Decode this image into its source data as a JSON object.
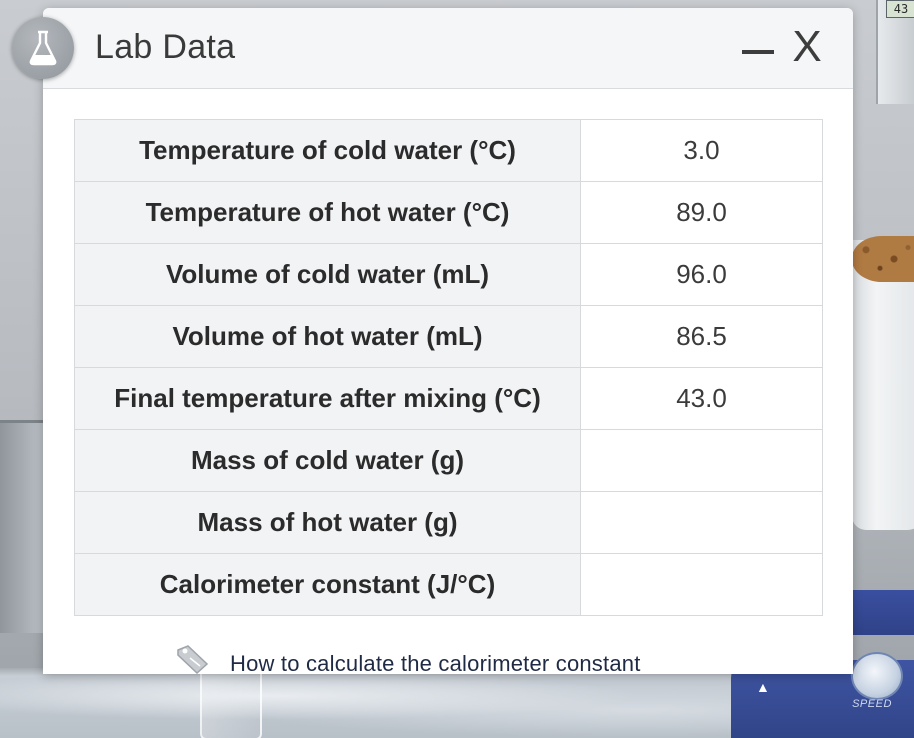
{
  "dialog": {
    "title": "Lab Data",
    "minimize_icon": "minimize-icon",
    "close_label": "X",
    "badge_icon": "flask-icon"
  },
  "table": {
    "rows": [
      {
        "label": "Temperature of cold water (°C)",
        "value": "3.0"
      },
      {
        "label": "Temperature of hot water (°C)",
        "value": "89.0"
      },
      {
        "label": "Volume of cold water (mL)",
        "value": "96.0"
      },
      {
        "label": "Volume of hot water (mL)",
        "value": "86.5"
      },
      {
        "label": "Final temperature after mixing (°C)",
        "value": "43.0"
      },
      {
        "label": "Mass of cold water (g)",
        "value": ""
      },
      {
        "label": "Mass of hot water (g)",
        "value": ""
      },
      {
        "label": "Calorimeter constant (J/°C)",
        "value": ""
      }
    ]
  },
  "help": {
    "link_text": "How to calculate the calorimeter constant",
    "icon": "tag-icon"
  },
  "background": {
    "probe_reading": "43",
    "stirrer_label": "SPEED",
    "warning_icon": "warning-icon"
  },
  "colors": {
    "header_bg": "#f5f6f7",
    "label_cell_bg": "#f2f3f5",
    "stirrer_blue": "#3f55a3"
  }
}
